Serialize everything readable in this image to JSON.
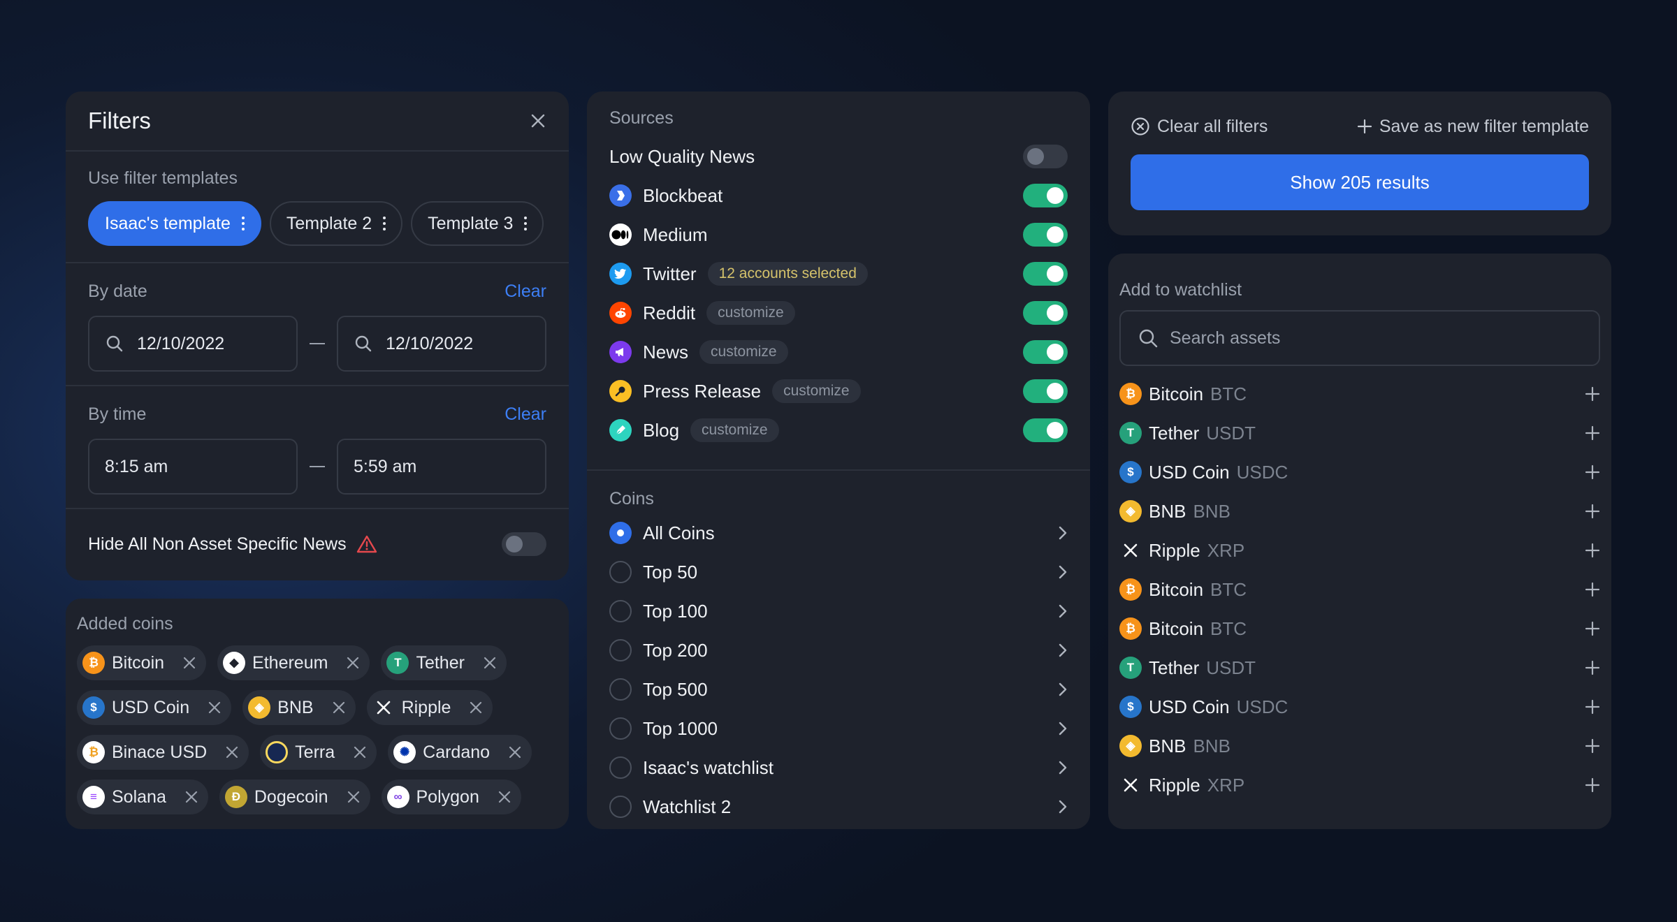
{
  "filters": {
    "title": "Filters",
    "templates_label": "Use filter templates",
    "templates": [
      "Isaac's template",
      "Template 2",
      "Template 3"
    ],
    "date": {
      "label": "By date",
      "clear": "Clear",
      "from": "12/10/2022",
      "to": "12/10/2022"
    },
    "time": {
      "label": "By time",
      "clear": "Clear",
      "from": "8:15 am",
      "to": "5:59 am"
    },
    "hide_non_asset": "Hide All Non Asset Specific News"
  },
  "added_coins": {
    "label": "Added coins",
    "coins": [
      "Bitcoin",
      "Ethereum",
      "Tether",
      "USD Coin",
      "BNB",
      "Ripple",
      "Binace USD",
      "Terra",
      "Cardano",
      "Solana",
      "Dogecoin",
      "Polygon"
    ]
  },
  "sources": {
    "label": "Sources",
    "low_quality": "Low Quality News",
    "items": [
      {
        "name": "Blockbeat",
        "tag": ""
      },
      {
        "name": "Medium",
        "tag": ""
      },
      {
        "name": "Twitter",
        "tag": "12 accounts selected"
      },
      {
        "name": "Reddit",
        "tag": "customize"
      },
      {
        "name": "News",
        "tag": "customize"
      },
      {
        "name": "Press Release",
        "tag": "customize"
      },
      {
        "name": "Blog",
        "tag": "customize"
      }
    ]
  },
  "coins": {
    "label": "Coins",
    "options": [
      "All Coins",
      "Top 50",
      "Top 100",
      "Top 200",
      "Top 500",
      "Top 1000",
      "Isaac's watchlist",
      "Watchlist 2"
    ],
    "selected": "All Coins"
  },
  "actions": {
    "clear_all": "Clear all filters",
    "save_template": "Save as new filter template",
    "show_results": "Show 205 results"
  },
  "watchlist": {
    "label": "Add to watchlist",
    "search_placeholder": "Search assets",
    "assets": [
      {
        "name": "Bitcoin",
        "symbol": "BTC"
      },
      {
        "name": "Tether",
        "symbol": "USDT"
      },
      {
        "name": "USD Coin",
        "symbol": "USDC"
      },
      {
        "name": "BNB",
        "symbol": "BNB"
      },
      {
        "name": "Ripple",
        "symbol": "XRP"
      },
      {
        "name": "Bitcoin",
        "symbol": "BTC"
      },
      {
        "name": "Bitcoin",
        "symbol": "BTC"
      },
      {
        "name": "Tether",
        "symbol": "USDT"
      },
      {
        "name": "USD Coin",
        "symbol": "USDC"
      },
      {
        "name": "BNB",
        "symbol": "BNB"
      },
      {
        "name": "Ripple",
        "symbol": "XRP"
      }
    ]
  },
  "colors": {
    "accent": "#2f6ee8",
    "toggle_on": "#22b07d",
    "card": "#1e222c",
    "warning": "#e5484d"
  }
}
